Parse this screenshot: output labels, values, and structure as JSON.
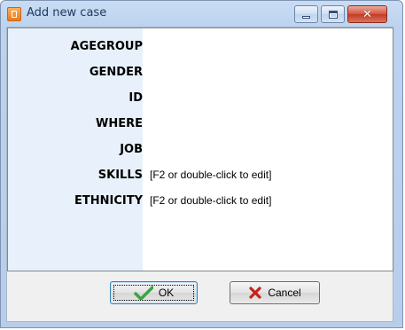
{
  "window": {
    "title": "Add new case"
  },
  "fields": [
    {
      "label": "AGEGROUP",
      "value": ""
    },
    {
      "label": "GENDER",
      "value": ""
    },
    {
      "label": "ID",
      "value": ""
    },
    {
      "label": "WHERE",
      "value": ""
    },
    {
      "label": "JOB",
      "value": ""
    },
    {
      "label": "SKILLS",
      "value": "[F2 or double-click to edit]"
    },
    {
      "label": "ETHNICITY",
      "value": "[F2 or double-click to edit]"
    }
  ],
  "buttons": {
    "ok": "OK",
    "cancel": "Cancel"
  },
  "icons": {
    "app": "case-app-icon",
    "ok": "check-icon",
    "cancel": "x-icon"
  },
  "colors": {
    "check": "#3aa640",
    "cross": "#c8221a",
    "label_bg": "#e8f1fb"
  }
}
